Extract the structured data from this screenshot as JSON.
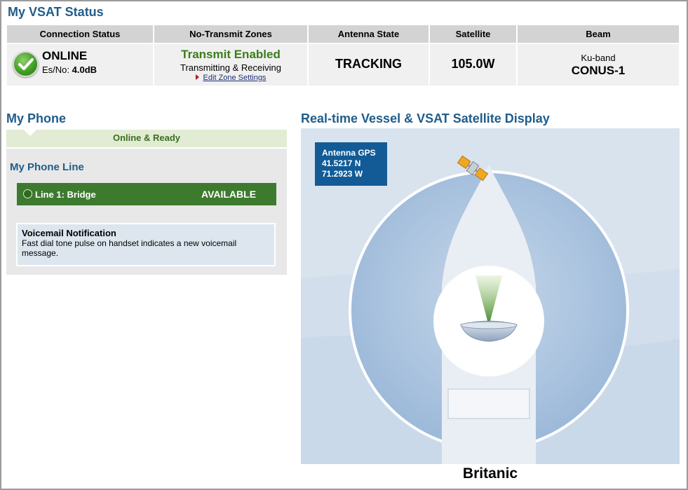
{
  "vsat": {
    "title": "My VSAT Status",
    "headers": {
      "connection": "Connection Status",
      "zones": "No-Transmit Zones",
      "antenna": "Antenna State",
      "satellite": "Satellite",
      "beam": "Beam"
    },
    "connection": {
      "status": "ONLINE",
      "esno_label": "Es/No:",
      "esno_value": "4.0dB",
      "icon": "checkmark-icon"
    },
    "zones": {
      "status": "Transmit Enabled",
      "detail": "Transmitting & Receiving",
      "edit_link": "Edit Zone Settings"
    },
    "antenna": {
      "state": "TRACKING"
    },
    "satellite": {
      "value": "105.0W"
    },
    "beam": {
      "band": "Ku-band",
      "name": "CONUS-1"
    }
  },
  "phone": {
    "title": "My Phone",
    "status": "Online & Ready",
    "line_title": "My Phone Line",
    "lines": [
      {
        "label": "Line 1: Bridge",
        "state": "AVAILABLE"
      }
    ],
    "voicemail": {
      "title": "Voicemail Notification",
      "text": "Fast dial tone pulse on handset indicates a new voicemail message."
    }
  },
  "display": {
    "title": "Real-time Vessel & VSAT Satellite Display",
    "gps": {
      "label": "Antenna GPS",
      "lat": "41.5217 N",
      "lon": "71.2923 W"
    },
    "vessel_name": "Britanic",
    "icons": [
      "satellite-icon",
      "vessel-icon",
      "antenna-dish-icon"
    ]
  },
  "colors": {
    "heading": "#1f5d8a",
    "transmit_enabled": "#3a7d1a",
    "line_available": "#3d7a2e",
    "gps_box": "#125b96",
    "display_bg": "#d9e3ee"
  }
}
